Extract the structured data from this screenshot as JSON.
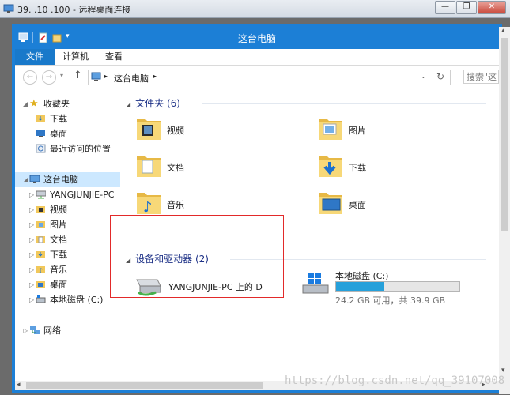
{
  "rdp": {
    "title": "39.   .10  .100 - 远程桌面连接",
    "minimize_icon": "minimize-icon",
    "restore_icon": "restore-icon",
    "close_icon": "close-icon"
  },
  "window": {
    "title": "这台电脑",
    "accent": "#1c7fd6"
  },
  "ribbon": {
    "tabs": [
      "文件",
      "计算机",
      "查看"
    ]
  },
  "address": {
    "path": "这台电脑",
    "search_placeholder": "搜索\"这"
  },
  "nav": {
    "items": [
      {
        "label": "收藏夹",
        "icon": "star-icon"
      },
      {
        "label": "下载",
        "icon": "download-folder-icon"
      },
      {
        "label": "桌面",
        "icon": "desktop-icon"
      },
      {
        "label": "最近访问的位置",
        "icon": "recent-places-icon"
      },
      {
        "label": "这台电脑",
        "icon": "computer-icon"
      },
      {
        "label": "YANGJUNJIE-PC 上",
        "icon": "network-drive-icon"
      },
      {
        "label": "视频",
        "icon": "videos-folder-icon"
      },
      {
        "label": "图片",
        "icon": "pictures-folder-icon"
      },
      {
        "label": "文档",
        "icon": "documents-folder-icon"
      },
      {
        "label": "下载",
        "icon": "download-folder-icon"
      },
      {
        "label": "音乐",
        "icon": "music-folder-icon"
      },
      {
        "label": "桌面",
        "icon": "desktop-folder-icon"
      },
      {
        "label": "本地磁盘 (C:)",
        "icon": "disk-icon"
      },
      {
        "label": "网络",
        "icon": "network-icon"
      }
    ]
  },
  "folders": {
    "header": "文件夹 (6)",
    "items": [
      {
        "label": "视频",
        "icon": "videos-folder-icon"
      },
      {
        "label": "图片",
        "icon": "pictures-folder-icon"
      },
      {
        "label": "文档",
        "icon": "documents-folder-icon"
      },
      {
        "label": "下载",
        "icon": "downloads-folder-icon"
      },
      {
        "label": "音乐",
        "icon": "music-folder-icon"
      },
      {
        "label": "桌面",
        "icon": "desktop-folder-icon"
      }
    ]
  },
  "devices": {
    "header": "设备和驱动器 (2)",
    "items": [
      {
        "label": "YANGJUNJIE-PC 上的 D",
        "icon": "redirected-drive-icon"
      },
      {
        "label": "本地磁盘 (C:)",
        "icon": "windows-disk-icon",
        "free_text": "24.2 GB 可用，共 39.9 GB",
        "used_fraction": 0.39
      }
    ]
  },
  "watermark": "https://blog.csdn.net/qq_39107008"
}
